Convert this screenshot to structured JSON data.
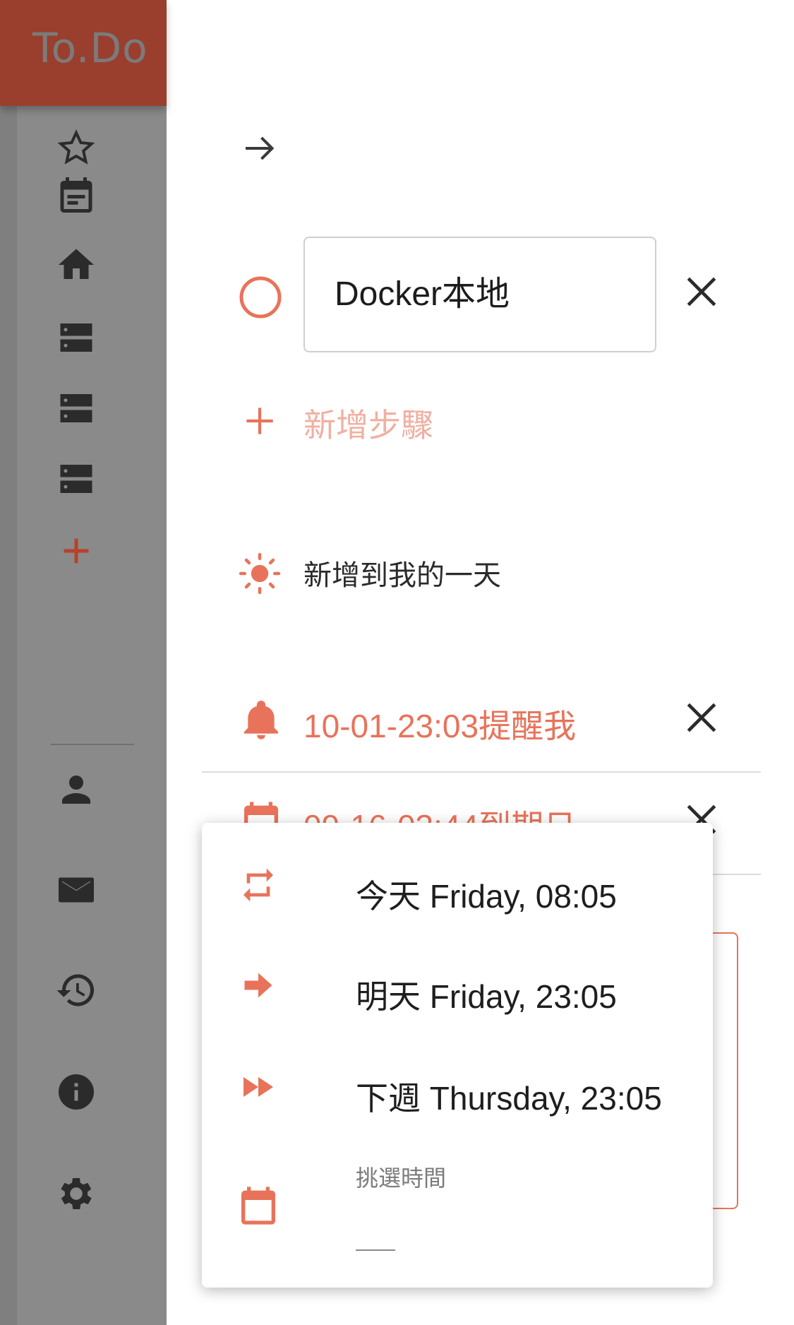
{
  "app": {
    "logo": "To.Do"
  },
  "sidebar": {
    "items": [
      {
        "icon": "star-outline-icon"
      },
      {
        "icon": "calendar-icon"
      },
      {
        "icon": "home-icon"
      },
      {
        "icon": "list-icon"
      },
      {
        "icon": "list-icon"
      },
      {
        "icon": "list-icon"
      },
      {
        "icon": "add-list-icon"
      }
    ],
    "bottom": [
      {
        "icon": "person-icon"
      },
      {
        "icon": "mail-icon"
      },
      {
        "icon": "history-icon"
      },
      {
        "icon": "info-icon"
      },
      {
        "icon": "settings-icon"
      }
    ]
  },
  "detail": {
    "task_title": "Docker本地",
    "add_step": "新增步驟",
    "add_to_my_day": "新增到我的一天",
    "reminder": "10-01-23:03提醒我",
    "due_date_partial": "09-16-03:44到期日"
  },
  "menu": {
    "options": [
      {
        "icon": "repeat-icon",
        "label": "今天 Friday, 08:05"
      },
      {
        "icon": "arrow-right-icon",
        "label": "明天 Friday, 23:05"
      },
      {
        "icon": "fast-forward-icon",
        "label": "下週 Thursday, 23:05"
      }
    ],
    "pick_time_label": "挑選時間",
    "pick_time_value": ""
  },
  "colors": {
    "accent": "#e8735a",
    "logo_bg": "#9a3f2e",
    "sidebar_bg": "#8a8a8a",
    "icon_dark": "#2b2b2b"
  }
}
